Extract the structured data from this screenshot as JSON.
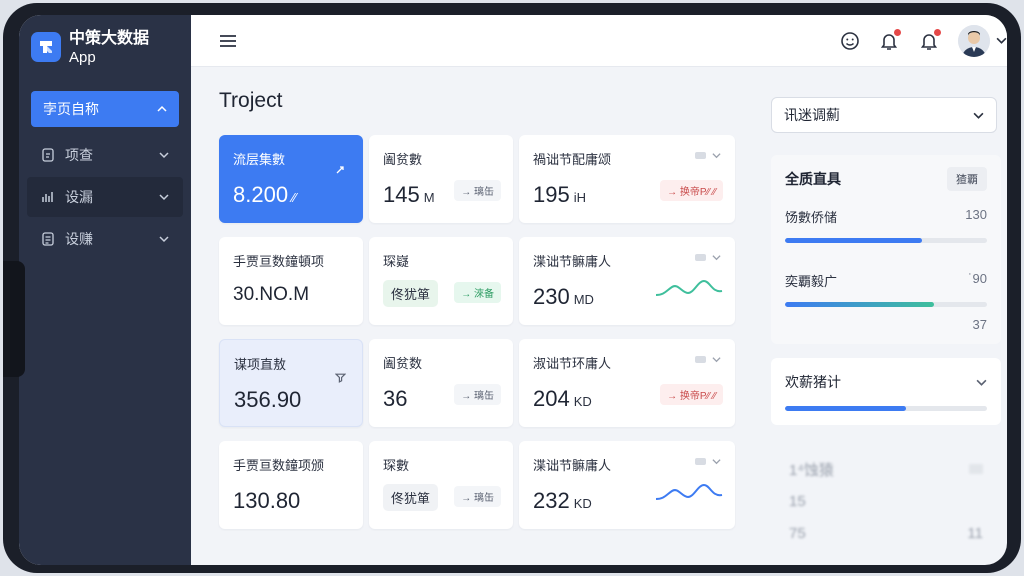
{
  "brand": {
    "name": "中策大数据",
    "sub": "App"
  },
  "sidebar": {
    "active": {
      "label": "孛页自称"
    },
    "items": [
      {
        "label": "项查",
        "icon": "document-icon"
      },
      {
        "label": "设漏",
        "icon": "bar-chart-icon"
      },
      {
        "label": "设赚",
        "icon": "list-icon"
      }
    ]
  },
  "page_title": "Troject",
  "cards": [
    {
      "label": "流层集數",
      "value": "8.200",
      "unit": "⁄⁄"
    },
    {
      "label": "阖贫數",
      "value": "145",
      "unit": "M",
      "tag": "→ 璃缶"
    },
    {
      "label": "禍诎节配庸颂",
      "value": "195",
      "unit": "iH",
      "tag": "→ 换帝P⁄⁄ ⁄⁄"
    },
    {
      "label": "手贾亘数鐘頓项",
      "value": "30.NO.M",
      "unit": ""
    },
    {
      "label": "琛嶷",
      "pill": "佟犹箪",
      "tag": "→ 淶备"
    },
    {
      "label": "渫诎节髍庸人",
      "value": "230",
      "unit": "MD"
    },
    {
      "label": "谋项直敖",
      "value": "356.90",
      "unit": ""
    },
    {
      "label": "阖贫数",
      "value": "36",
      "unit": "",
      "tag": "→ 璃缶"
    },
    {
      "label": "淑诎节环庸人",
      "value": "204",
      "unit": "KD",
      "tag": "→ 换帝P⁄⁄ ⁄⁄"
    },
    {
      "label": "手贾亘数鐘项颁",
      "value": "130.80",
      "unit": ""
    },
    {
      "label": "琛數",
      "pill": "佟犹箪",
      "tag": "→ 璃缶"
    },
    {
      "label": "渫诎节髍庸人",
      "value": "232",
      "unit": "KD"
    }
  ],
  "right": {
    "select": "讯迷调薊",
    "panel_title": "全质直具",
    "panel_btn": "猹覇",
    "stats": [
      {
        "label": "饧數侨储",
        "value": "130",
        "fill": 0.68
      },
      {
        "label": "奕覇毅广",
        "value": "˙90",
        "fill": 0.74,
        "extra": "37"
      }
    ],
    "panel2_title": "欢薪猪计",
    "panel2_fill": 0.6,
    "blurry": [
      {
        "a": "1⁴蚀猿",
        "b": ""
      },
      {
        "a": "15",
        "b": ""
      },
      {
        "a": "75",
        "b": "11"
      }
    ]
  },
  "colors": {
    "accent": "#3d7bf2",
    "sidebar": "#2a3246",
    "teal": "#3fbf9c"
  }
}
